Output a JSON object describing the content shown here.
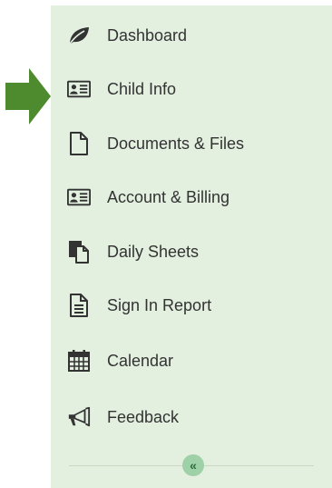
{
  "sidebar": {
    "items": [
      {
        "label": "Dashboard",
        "icon": "leaf-icon"
      },
      {
        "label": "Child Info",
        "icon": "id-card-icon"
      },
      {
        "label": "Documents & Files",
        "icon": "file-icon"
      },
      {
        "label": "Account & Billing",
        "icon": "id-card-icon"
      },
      {
        "label": "Daily Sheets",
        "icon": "copy-icon"
      },
      {
        "label": "Sign In Report",
        "icon": "file-text-icon"
      },
      {
        "label": "Calendar",
        "icon": "calendar-icon"
      },
      {
        "label": "Feedback",
        "icon": "bullhorn-icon"
      }
    ],
    "collapse_label": "«",
    "background_color": "#e3efdf",
    "pointer_color": "#4e8a2e"
  }
}
